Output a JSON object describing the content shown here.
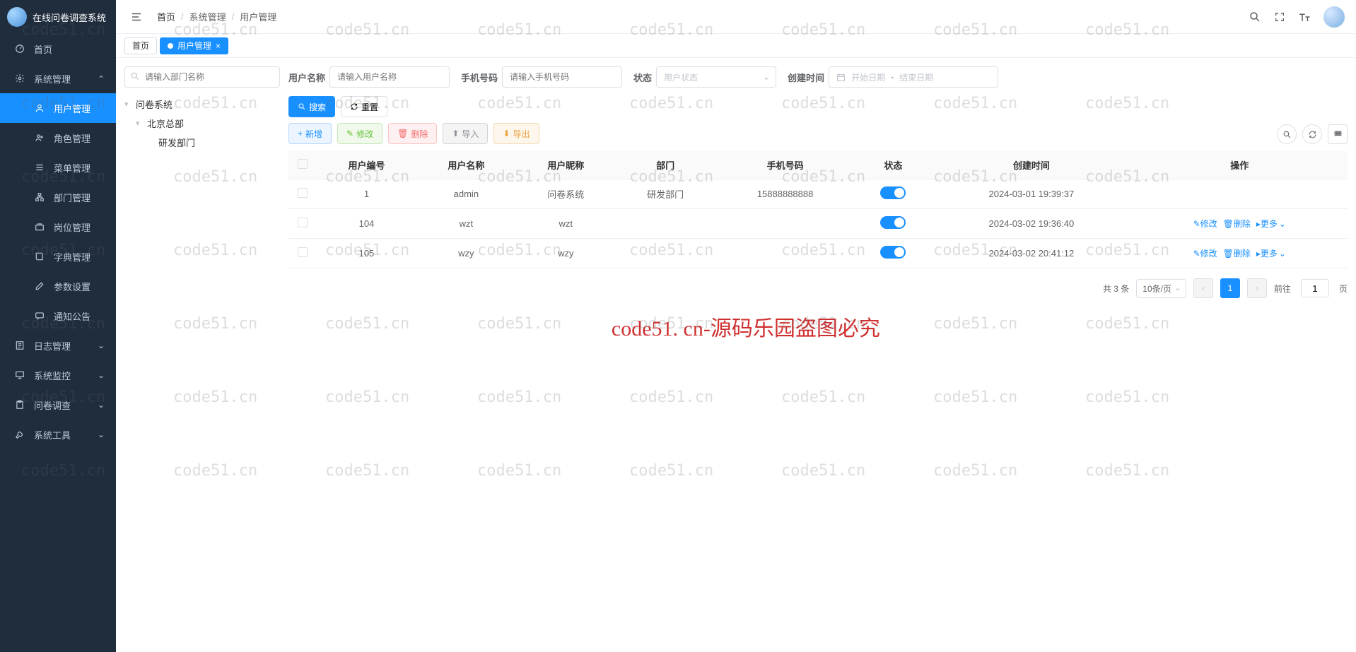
{
  "app": {
    "title": "在线问卷调查系统"
  },
  "sidebar": {
    "home": "首页",
    "sysManage": "系统管理",
    "sub": {
      "userManage": "用户管理",
      "roleManage": "角色管理",
      "menuManage": "菜单管理",
      "deptManage": "部门管理",
      "postManage": "岗位管理",
      "dictManage": "字典管理",
      "paramSet": "参数设置",
      "notice": "通知公告",
      "logManage": "日志管理"
    },
    "sysMonitor": "系统监控",
    "survey": "问卷调查",
    "sysTools": "系统工具"
  },
  "breadcrumb": {
    "home": "首页",
    "sys": "系统管理",
    "user": "用户管理"
  },
  "tabs": {
    "home": "首页",
    "userManage": "用户管理"
  },
  "filters": {
    "deptPlaceholder": "请输入部门名称",
    "userNameLabel": "用户名称",
    "userNamePlaceholder": "请输入用户名称",
    "phoneLabel": "手机号码",
    "phonePlaceholder": "请输入手机号码",
    "statusLabel": "状态",
    "statusPlaceholder": "用户状态",
    "createTimeLabel": "创建时间",
    "startDate": "开始日期",
    "endDate": "结束日期"
  },
  "tree": {
    "root": "问卷系统",
    "child1": "北京总部",
    "child2": "研发部门"
  },
  "buttons": {
    "search": "搜索",
    "reset": "重置",
    "add": "新增",
    "edit": "修改",
    "delete": "删除",
    "import": "导入",
    "export": "导出"
  },
  "table": {
    "headers": {
      "userId": "用户编号",
      "userName": "用户名称",
      "nickName": "用户昵称",
      "dept": "部门",
      "phone": "手机号码",
      "status": "状态",
      "createTime": "创建时间",
      "action": "操作"
    },
    "rows": [
      {
        "id": "1",
        "name": "admin",
        "nick": "问卷系统",
        "dept": "研发部门",
        "phone": "15888888888",
        "create": "2024-03-01 19:39:37"
      },
      {
        "id": "104",
        "name": "wzt",
        "nick": "wzt",
        "dept": "",
        "phone": "",
        "create": "2024-03-02 19:36:40"
      },
      {
        "id": "105",
        "name": "wzy",
        "nick": "wzy",
        "dept": "",
        "phone": "",
        "create": "2024-03-02 20:41:12"
      }
    ],
    "actions": {
      "edit": "修改",
      "delete": "删除",
      "more": "更多"
    }
  },
  "pagination": {
    "total": "共 3 条",
    "pageSize": "10条/页",
    "goto": "前往",
    "page": "1",
    "pageSuffix": "页"
  },
  "watermark": {
    "repeat": "code51.cn",
    "center": "code51. cn-源码乐园盗图必究"
  }
}
